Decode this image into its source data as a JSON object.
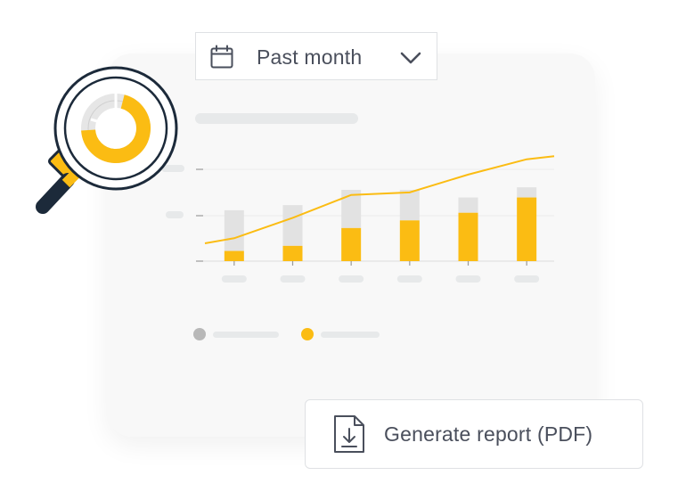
{
  "date_filter": {
    "selected": "Past month",
    "calendar_icon": "calendar-icon",
    "chevron_icon": "chevron-down-icon"
  },
  "report_button": {
    "label": "Generate report (PDF)",
    "icon": "pdf-download-icon"
  },
  "magnifier": {
    "icon": "magnifier-icon",
    "donut_fraction_highlight": 0.7
  },
  "colors": {
    "accent": "#fbbc13",
    "muted_bar": "#e2e2e2",
    "placeholder": "#e7e9ea",
    "text": "#4a4f5c",
    "card": "#f8f8f8",
    "magnifier_outline": "#1c2a3a"
  },
  "chart_data": {
    "type": "bar",
    "categories": [
      "",
      "",
      "",
      "",
      "",
      ""
    ],
    "series": [
      {
        "values": [
          2,
          3,
          6.5,
          8,
          9.5,
          12.5
        ]
      },
      {
        "values": [
          8,
          8,
          7.5,
          6,
          3,
          2
        ]
      }
    ],
    "line": [
      4.5,
      8.5,
      13,
      13.5,
      17,
      20
    ],
    "stacked": true,
    "ylim": [
      0,
      21
    ],
    "grid": true,
    "legend_position": "bottom-left"
  }
}
